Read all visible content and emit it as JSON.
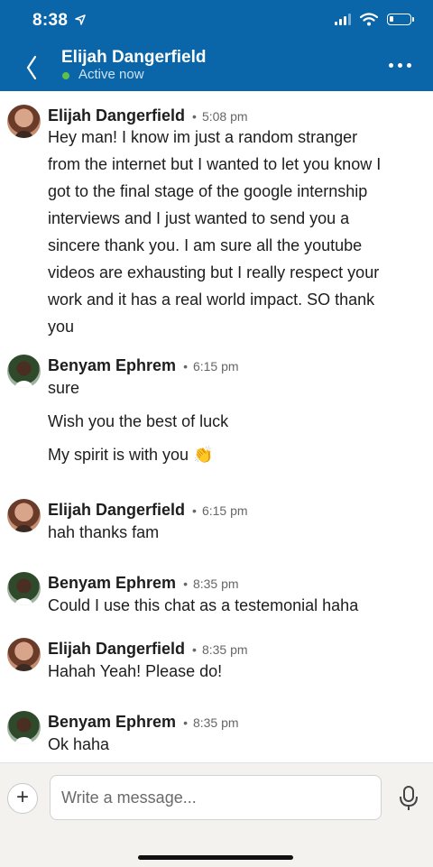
{
  "status_bar": {
    "time": "8:38"
  },
  "header": {
    "contact_name": "Elijah Dangerfield",
    "status": "Active now"
  },
  "messages": [
    {
      "sender": "Elijah Dangerfield",
      "time": "5:08 pm",
      "avatar": "elijah",
      "lines": [
        "Hey man! I know im just a random stranger",
        "from the internet but I wanted to let you know I",
        "got to the final stage of the google internship",
        "interviews and I just wanted to send you a",
        "sincere thank you. I am sure all the youtube",
        "videos are exhausting but I really respect your",
        "work and it has a real world impact. SO thank",
        "you"
      ]
    },
    {
      "sender": "Benyam Ephrem",
      "time": "6:15 pm",
      "avatar": "benyam",
      "lines": [
        "sure",
        "Wish you the best of luck",
        "My spirit is with you 👏"
      ]
    },
    {
      "sender": "Elijah Dangerfield",
      "time": "6:15 pm",
      "avatar": "elijah",
      "lines": [
        "hah thanks fam"
      ]
    },
    {
      "sender": "Benyam Ephrem",
      "time": "8:35 pm",
      "avatar": "benyam",
      "lines": [
        "Could I use this chat as a testemonial haha"
      ]
    },
    {
      "sender": "Elijah Dangerfield",
      "time": "8:35 pm",
      "avatar": "elijah",
      "lines": [
        "Hahah Yeah! Please do!"
      ]
    },
    {
      "sender": "Benyam Ephrem",
      "time": "8:35 pm",
      "avatar": "benyam",
      "lines": [
        "Ok haha"
      ]
    }
  ],
  "composer": {
    "placeholder": "Write a message...",
    "plus_label": "+"
  },
  "colors": {
    "header": "#0a66a8",
    "active_dot": "#5fbf4a"
  },
  "icons": [
    "location-arrow-icon",
    "signal-icon",
    "wifi-icon",
    "battery-icon",
    "back-chevron-icon",
    "more-icon",
    "plus-icon",
    "microphone-icon"
  ]
}
